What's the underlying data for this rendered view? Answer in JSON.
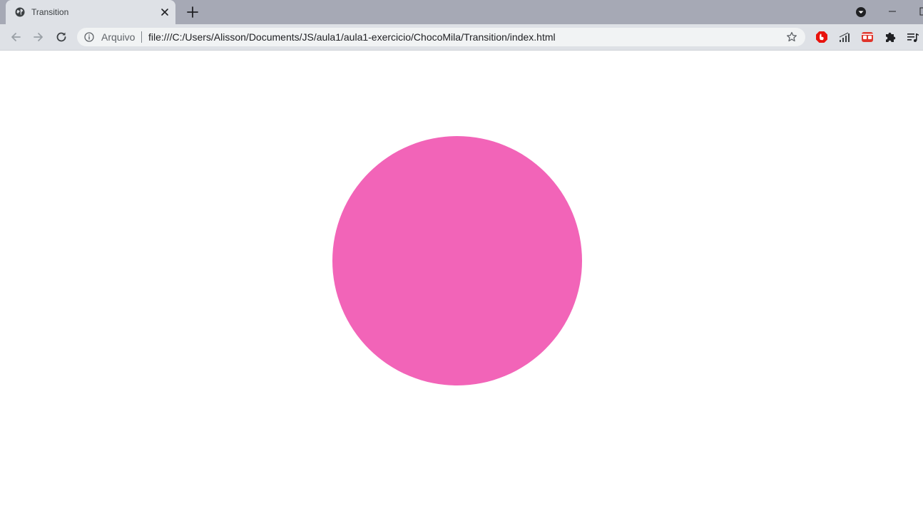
{
  "browser": {
    "tab": {
      "title": "Transition",
      "favicon_icon": "globe-icon",
      "close_icon": "close-icon"
    },
    "new_tab_icon": "plus-icon",
    "window_controls": {
      "profile_icon": "chevron-down-circle-icon",
      "minimize_icon": "minimize-icon"
    },
    "toolbar": {
      "back_icon": "arrow-left-icon",
      "forward_icon": "arrow-right-icon",
      "reload_icon": "reload-icon",
      "security_label": "Arquivo",
      "url": "file:///C:/Users/Alisson/Documents/JS/aula1/aula1-exercicio/ChocoMila/Transition/index.html",
      "bookmark_icon": "star-icon",
      "extensions": [
        "adblock-icon",
        "signal-icon",
        "tomato-icon",
        "puzzle-icon",
        "reading-list-icon"
      ]
    },
    "colors": {
      "tabstrip": "#a6a9b5",
      "toolbar": "#dee1e6",
      "omnibox": "#f1f3f4"
    }
  },
  "page": {
    "ball": {
      "color": "#f264b8"
    }
  }
}
